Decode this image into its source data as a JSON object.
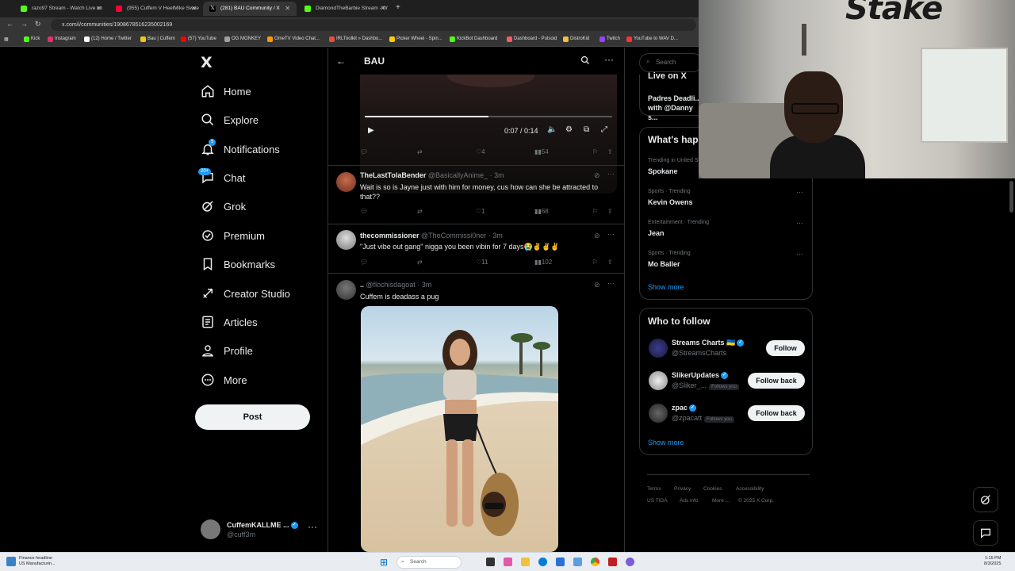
{
  "browser": {
    "tabs": [
      {
        "label": "razo97 Stream - Watch Live on",
        "color": "#53fc18"
      },
      {
        "label": "(955) Cuffem V HeelMike Swee",
        "color": "#ff0033"
      },
      {
        "label": "(281) BAU Community / X",
        "color": "#ffffff"
      },
      {
        "label": "DiamondTheBarbie Stream - W",
        "color": "#53fc18"
      }
    ],
    "url": "x.com/i/communities/1908678516235002169",
    "bookmarks": [
      {
        "label": "Kick",
        "color": "#53fc18"
      },
      {
        "label": "Instagram",
        "color": "#e1306c"
      },
      {
        "label": "(12) Home / Twitter",
        "color": "#ffffff"
      },
      {
        "label": "Bau | Cuffem",
        "color": "#f5c518"
      },
      {
        "label": "(57) YouTube",
        "color": "#ff0000"
      },
      {
        "label": "OG MONKEY",
        "color": "#a0a0a0"
      },
      {
        "label": "OmeTV Video Chat...",
        "color": "#ff9900"
      },
      {
        "label": "IRLToolkit » Dashbo...",
        "color": "#e94e3c"
      },
      {
        "label": "Picker Wheel - Spin...",
        "color": "#ffcc00"
      },
      {
        "label": "KickBot Dashboard",
        "color": "#53fc18"
      },
      {
        "label": "Dashboard - Pulsoid",
        "color": "#ff5a5a"
      },
      {
        "label": "DistroKid",
        "color": "#f0c040"
      },
      {
        "label": "Twitch",
        "color": "#9146ff"
      },
      {
        "label": "YouTube to WAV D...",
        "color": "#ff3333"
      }
    ]
  },
  "sidebar": {
    "logo": "X",
    "items": [
      {
        "label": "Home",
        "icon": "home-icon"
      },
      {
        "label": "Explore",
        "icon": "search-icon"
      },
      {
        "label": "Notifications",
        "icon": "bell-icon",
        "badge": "5"
      },
      {
        "label": "Chat",
        "icon": "chat-icon",
        "badge": "20+"
      },
      {
        "label": "Grok",
        "icon": "grok-icon"
      },
      {
        "label": "Premium",
        "icon": "premium-icon"
      },
      {
        "label": "Bookmarks",
        "icon": "bookmark-icon"
      },
      {
        "label": "Creator Studio",
        "icon": "rocket-icon"
      },
      {
        "label": "Articles",
        "icon": "article-icon"
      },
      {
        "label": "Profile",
        "icon": "person-icon"
      },
      {
        "label": "More",
        "icon": "more-circle-icon"
      }
    ],
    "post_label": "Post",
    "account": {
      "name": "CuffemKALLME ...",
      "handle": "@cuff3m"
    }
  },
  "feed": {
    "title": "BAU",
    "video": {
      "time": "0:07 / 0:14",
      "progress": 0.5
    },
    "video_actions": {
      "likes": "4",
      "views": "54"
    },
    "tweets": [
      {
        "name": "TheLastTolaBender",
        "handle": "@BasicallyAnime_",
        "time": "3m",
        "text": "Wait is so is Jayne just with him for money, cus how can she be attracted to that??",
        "replies": "",
        "reposts": "",
        "likes": "1",
        "views": "68"
      },
      {
        "name": "thecommissioner",
        "handle": "@TheCommissi0ner",
        "time": "3m",
        "text": "\"Just vibe out gang\" nigga you been vibin for 7 days😭✌️✌️✌️",
        "replies": "",
        "reposts": "",
        "likes": "11",
        "views": "102"
      },
      {
        "name": "..",
        "handle": "@flochisdagoat",
        "time": "3m",
        "text": "Cuffem is deadass a pug"
      }
    ]
  },
  "right": {
    "search_placeholder": "Search",
    "live_title": "Live on X",
    "live_text": "Padres Deadli... with @Danny s...",
    "whats_happening": "What's happening",
    "trends": [
      {
        "category": "Trending in United States",
        "name": "Spokane"
      },
      {
        "category": "Sports · Trending",
        "name": "Kevin Owens"
      },
      {
        "category": "Entertainment · Trending",
        "name": "Jean"
      },
      {
        "category": "Sports · Trending",
        "name": "Mo Baller"
      }
    ],
    "show_more": "Show more",
    "who_to_follow": "Who to follow",
    "follow": [
      {
        "name": "Streams Charts 🇺🇦",
        "handle": "@StreamsCharts",
        "follows_you": "",
        "button": "Follow"
      },
      {
        "name": "SlikerUpdates",
        "handle": "@Sliker_...",
        "follows_you": "Follows you",
        "button": "Follow back"
      },
      {
        "name": "zpac",
        "handle": "@zpacatt",
        "follows_you": "Follows you",
        "button": "Follow back"
      }
    ],
    "show_more_2": "Show more",
    "footer": [
      "Terms",
      "Privacy",
      "Cookies",
      "Accessibility",
      "US TIDA",
      "Ads info",
      "More ...",
      "© 2025 X Corp."
    ]
  },
  "webcam": {
    "brand": "Stake"
  },
  "taskbar": {
    "news_title": "Finance headline",
    "news_sub": "US Manufacturin...",
    "search": "Search",
    "time": "1:15 PM",
    "date": "8/3/2025"
  }
}
